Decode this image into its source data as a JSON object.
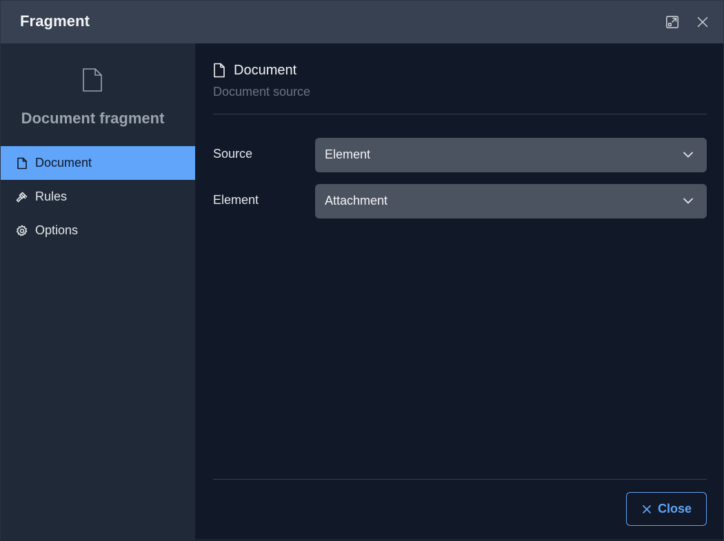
{
  "window": {
    "title": "Fragment",
    "expand_icon": "expand-icon",
    "close_icon": "close-icon"
  },
  "sidebar": {
    "header_icon": "document-icon",
    "title": "Document fragment",
    "items": [
      {
        "label": "Document",
        "icon": "document-icon",
        "active": true
      },
      {
        "label": "Rules",
        "icon": "gavel-icon",
        "active": false
      },
      {
        "label": "Options",
        "icon": "gear-icon",
        "active": false
      }
    ]
  },
  "main": {
    "header_icon": "document-icon",
    "title": "Document",
    "subtitle": "Document source",
    "fields": [
      {
        "label": "Source",
        "value": "Element"
      },
      {
        "label": "Element",
        "value": "Attachment"
      }
    ]
  },
  "footer": {
    "close_label": "Close"
  },
  "colors": {
    "accent": "#60a5fa",
    "titlebar": "#374151",
    "sidebar": "#1f2937",
    "background": "#111827",
    "select": "#4b5260"
  }
}
